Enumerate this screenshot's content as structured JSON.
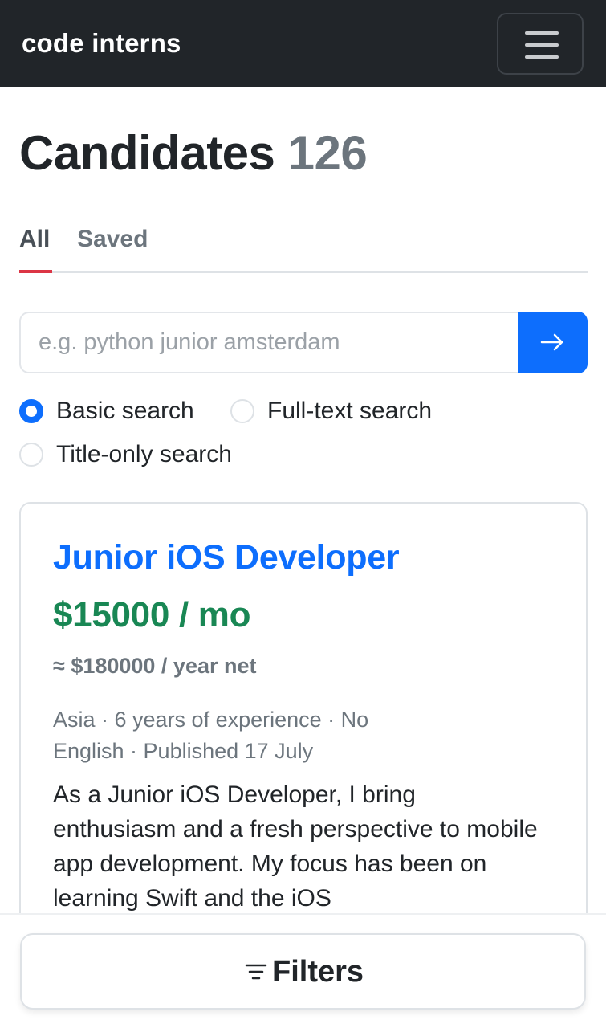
{
  "navbar": {
    "brand": "code interns",
    "menu_icon": "hamburger-menu-icon"
  },
  "header": {
    "title": "Candidates",
    "count": "126"
  },
  "tabs": [
    {
      "label": "All",
      "active": true
    },
    {
      "label": "Saved",
      "active": false
    }
  ],
  "search": {
    "value": "",
    "placeholder": "e.g. python junior amsterdam",
    "button_icon": "arrow-right-icon"
  },
  "search_modes": [
    {
      "label": "Basic search",
      "checked": true
    },
    {
      "label": "Full-text search",
      "checked": false
    },
    {
      "label": "Title-only search",
      "checked": false
    }
  ],
  "candidate": {
    "title": "Junior iOS Developer",
    "salary_month": "$15000 / mo",
    "salary_year": "≈ $180000 / year net",
    "meta": "Asia · 6 years of experience · No English · Published 17 July",
    "description": "As a Junior iOS Developer, I bring enthusiasm and a fresh perspective to mobile app development. My focus has been on learning Swift and the iOS"
  },
  "filters": {
    "label": "Filters",
    "icon": "filter-icon"
  },
  "colors": {
    "navbar": "#212529",
    "primary": "#0d6efd",
    "salary": "#198754",
    "tab_active_underline": "#dc3545",
    "muted": "#6c757d"
  }
}
